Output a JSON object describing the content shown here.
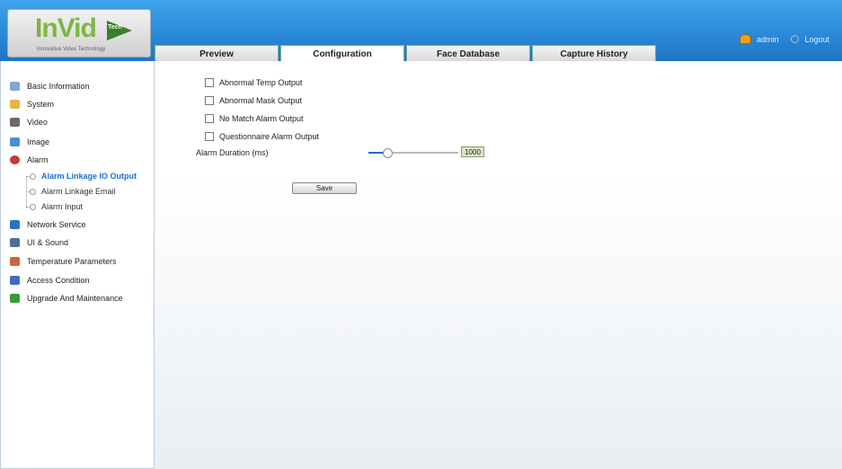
{
  "brand": {
    "logo_text": "InVid",
    "logo_tech": "Tech",
    "logo_subtitle": "Innovative Video Technology"
  },
  "tabs": [
    {
      "label": "Preview",
      "active": false
    },
    {
      "label": "Configuration",
      "active": true
    },
    {
      "label": "Face Database",
      "active": false
    },
    {
      "label": "Capture History",
      "active": false
    }
  ],
  "user": {
    "name": "admin",
    "logout_label": "Logout"
  },
  "sidebar": {
    "items": [
      {
        "label": "Basic Information",
        "icon": "info-icon",
        "color": "#7fa6d6"
      },
      {
        "label": "System",
        "icon": "system-icon",
        "color": "#e8b24a"
      },
      {
        "label": "Video",
        "icon": "video-icon",
        "color": "#6a6a6a"
      },
      {
        "label": "Image",
        "icon": "image-icon",
        "color": "#4a8fd0"
      },
      {
        "label": "Alarm",
        "icon": "alarm-icon",
        "color": "#c33b3b"
      },
      {
        "label": "Network Service",
        "icon": "network-icon",
        "color": "#2f6fc4"
      },
      {
        "label": "UI & Sound",
        "icon": "ui-sound-icon",
        "color": "#4d6f9b"
      },
      {
        "label": "Temperature Parameters",
        "icon": "temperature-icon",
        "color": "#c9673c"
      },
      {
        "label": "Access Condition",
        "icon": "access-icon",
        "color": "#3a6fbf"
      },
      {
        "label": "Upgrade And Maintenance",
        "icon": "upgrade-icon",
        "color": "#3a9a3a"
      }
    ],
    "alarm_subitems": [
      {
        "label": "Alarm Linkage IO Output",
        "active": true
      },
      {
        "label": "Alarm Linkage Email",
        "active": false
      },
      {
        "label": "Alarm Input",
        "active": false
      }
    ]
  },
  "main": {
    "checkboxes": [
      {
        "label": "Abnormal Temp Output",
        "checked": false
      },
      {
        "label": "Abnormal Mask Output",
        "checked": false
      },
      {
        "label": "No Match Alarm Output",
        "checked": false
      },
      {
        "label": "Questionnaire Alarm Output",
        "checked": false
      }
    ],
    "duration_label": "Alarm Duration (ms)",
    "duration_value": "1000",
    "duration_fraction": 0.2,
    "save_label": "Save"
  },
  "colors": {
    "header_blue": "#2b8ad8",
    "active_link": "#1b6fd6",
    "slider_fill": "#1668d6",
    "value_box": "#d7e8c4"
  }
}
